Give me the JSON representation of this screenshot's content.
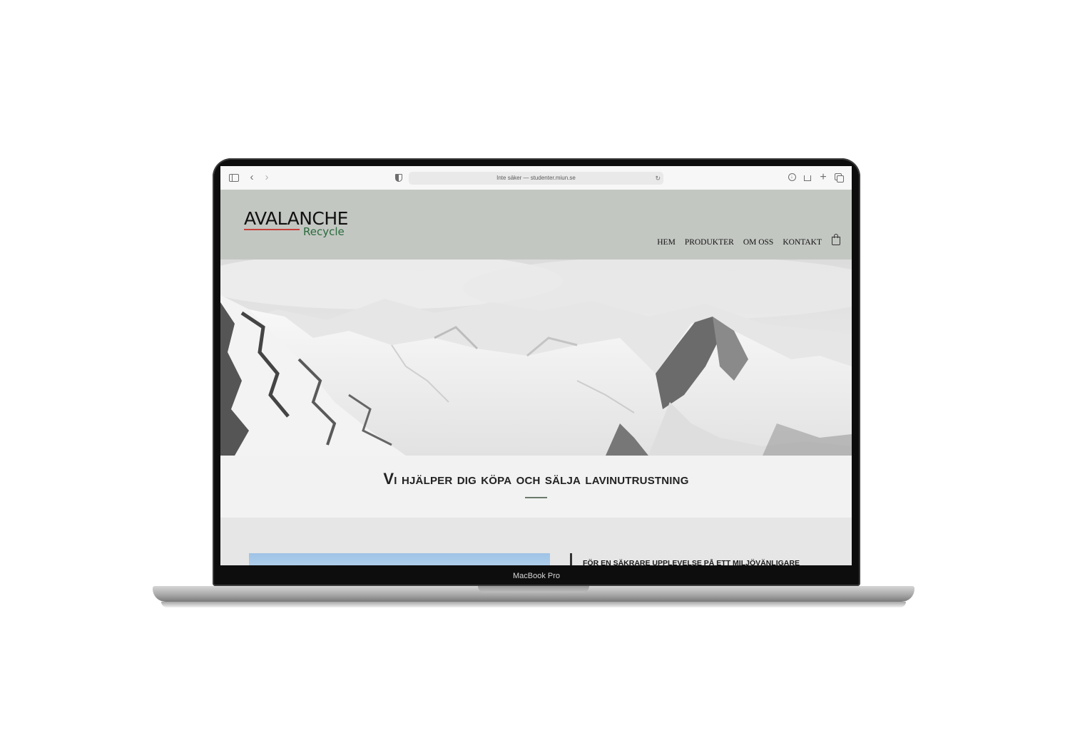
{
  "device": {
    "label": "MacBook Pro"
  },
  "browser": {
    "address": "Inte säker — studenter.miun.se",
    "icons": [
      "sidebar-icon",
      "back-icon",
      "forward-icon",
      "shield-icon",
      "reload-icon",
      "download-icon",
      "share-icon",
      "new-tab-icon",
      "tabs-icon"
    ]
  },
  "site": {
    "logo": {
      "main": "AVALANCHE",
      "sub": "Recycle"
    },
    "nav": [
      {
        "label": "HEM"
      },
      {
        "label": "PRODUKTER"
      },
      {
        "label": "OM OSS"
      },
      {
        "label": "KONTAKT"
      }
    ],
    "cart_icon": "shopping-bag-icon",
    "hero": {
      "image": "snowy-mountains-photo"
    },
    "intro": {
      "title": "Vi hjälper dig köpa och sälja lavinutrustning"
    },
    "content": {
      "heading": "FÖR EN SÄKRARE UPPLEVELSE PÅ ETT MILJÖVÄNLIGARE"
    }
  },
  "colors": {
    "header_bg": "#c3c7c2",
    "logo_accent_red": "#c8413c",
    "logo_green": "#2a6b3c",
    "intro_bg": "#f2f2f2",
    "rule": "#6b7a6c"
  }
}
